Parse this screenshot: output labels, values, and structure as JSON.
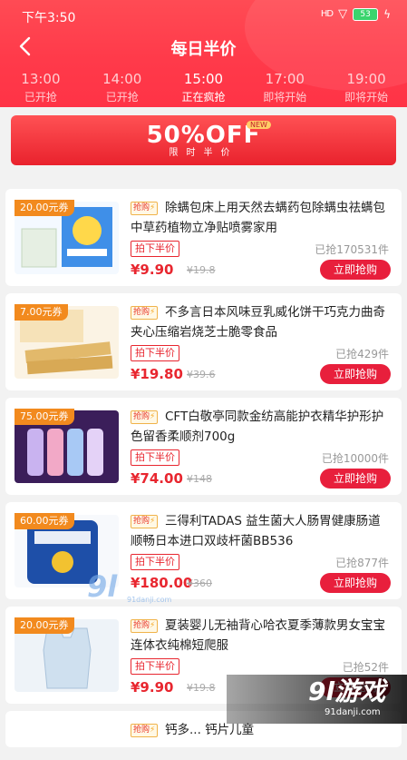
{
  "status_bar": {
    "time": "下午3:50",
    "signal": "HD",
    "battery": "53"
  },
  "nav": {
    "title": "每日半价"
  },
  "time_slots": [
    {
      "time": "13:00",
      "status": "已开抢"
    },
    {
      "time": "14:00",
      "status": "已开抢"
    },
    {
      "time": "15:00",
      "status": "正在疯抢"
    },
    {
      "time": "17:00",
      "status": "即将开始"
    },
    {
      "time": "19:00",
      "status": "即将开始"
    }
  ],
  "banner": {
    "main": "50%OFF",
    "sub": "限时半价",
    "tag": "NEW"
  },
  "product_tag": "抢购",
  "halfprice_label": "拍下半价",
  "buy_label": "立即抢购",
  "products": [
    {
      "coupon": "20.00元券",
      "title": "除螨包床上用天然去螨药包除螨虫祛螨包中草药植物立净贴喷雾家用",
      "sold": "已抢170531件",
      "price": "¥9.90",
      "price_old": "¥19.8"
    },
    {
      "coupon": "7.00元券",
      "title": "不多言日本风味豆乳威化饼干巧克力曲奇夹心压缩岩烧芝士脆零食品",
      "sold": "已抢429件",
      "price": "¥19.80",
      "price_old": "¥39.6"
    },
    {
      "coupon": "75.00元券",
      "title": "CFT白敬亭同款金纺高能护衣精华护形护色留香柔顺剂700g",
      "sold": "已抢10000件",
      "price": "¥74.00",
      "price_old": "¥148"
    },
    {
      "coupon": "60.00元券",
      "title": "三得利TADAS 益生菌大人肠胃健康肠道顺畅日本进口双歧杆菌BB536",
      "sold": "已抢877件",
      "price": "¥180.00",
      "price_old": "¥360"
    },
    {
      "coupon": "20.00元券",
      "title": "夏装婴儿无袖背心哈衣夏季薄款男女宝宝连体衣纯棉短爬服",
      "sold": "已抢52件",
      "price": "¥9.90",
      "price_old": "¥19.8"
    },
    {
      "coupon": "",
      "title": "钙多... 钙片儿童",
      "sold": "",
      "price": "",
      "price_old": ""
    }
  ],
  "watermark": {
    "logo": "9l游戏",
    "url": "91danji.com",
    "mid": "9l",
    "mid_url": "91danji.com"
  }
}
